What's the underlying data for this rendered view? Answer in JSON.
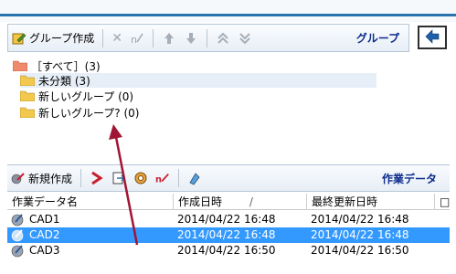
{
  "group_panel": {
    "toolbar": {
      "create_group_label": "グループ作成",
      "panel_title": "グループ"
    },
    "tree": {
      "items": [
        {
          "label": "［すべて］(3)"
        },
        {
          "label": "未分類 (3)"
        },
        {
          "label": "新しいグループ (0)"
        },
        {
          "label": "新しいグループ? (0)"
        }
      ]
    }
  },
  "work_panel": {
    "toolbar": {
      "new_label": "新規作成",
      "panel_title": "作業データ"
    },
    "table": {
      "headers": [
        "作業データ名",
        "作成日時",
        "最終更新日時",
        "□"
      ],
      "sort_indicator": "/",
      "rows": [
        {
          "name": "CAD1",
          "created": "2014/04/22 16:48",
          "updated": "2014/04/22 16:48"
        },
        {
          "name": "CAD2",
          "created": "2014/04/22 16:48",
          "updated": "2014/04/22 16:48"
        },
        {
          "name": "CAD3",
          "created": "2014/04/22 16:50",
          "updated": "2014/04/22 16:50"
        }
      ]
    }
  },
  "colors": {
    "accent_blue": "#2b74ad",
    "selection": "#3399ff",
    "label_blue": "#0c2c8c",
    "arrow_red": "#a01434",
    "folder_yellow": "#f2c94c"
  }
}
